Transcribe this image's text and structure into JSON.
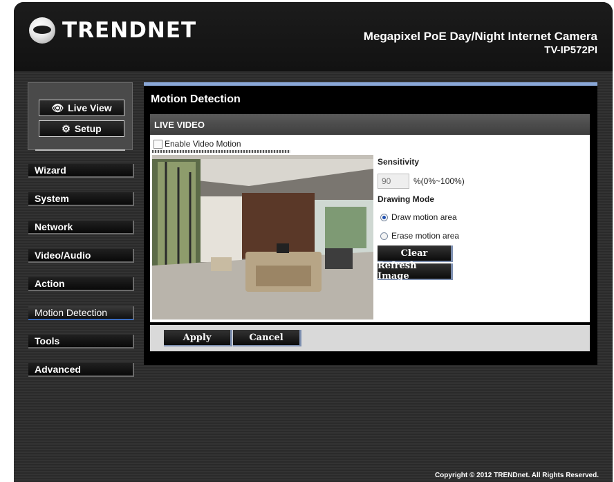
{
  "brand": {
    "name": "TRENDNET"
  },
  "header": {
    "product_title": "Megapixel PoE Day/Night Internet Camera",
    "model": "TV-IP572PI"
  },
  "top_nav": {
    "live_view": "Live View",
    "setup": "Setup"
  },
  "menu": [
    {
      "label": "Wizard"
    },
    {
      "label": "System"
    },
    {
      "label": "Network"
    },
    {
      "label": "Video/Audio"
    },
    {
      "label": "Action"
    },
    {
      "label": "Motion Detection",
      "active": true
    },
    {
      "label": "Tools"
    },
    {
      "label": "Advanced"
    }
  ],
  "panel": {
    "title": "Motion Detection",
    "section": "LIVE VIDEO",
    "enable_label": "Enable Video Motion",
    "sensitivity_label": "Sensitivity",
    "sensitivity_value": "90",
    "sensitivity_range": "%(0%~100%)",
    "drawing_mode_label": "Drawing Mode",
    "draw_label": "Draw motion area",
    "erase_label": "Erase motion area",
    "clear_label": "Clear",
    "refresh_label": "Refresh Image",
    "apply_label": "Apply",
    "cancel_label": "Cancel"
  },
  "footer": {
    "copyright": "Copyright © 2012 TRENDnet. All Rights Reserved."
  },
  "colors": {
    "accent": "#8aa8d8",
    "panel_bg": "#000000",
    "button_border": "#7d8fb0"
  }
}
